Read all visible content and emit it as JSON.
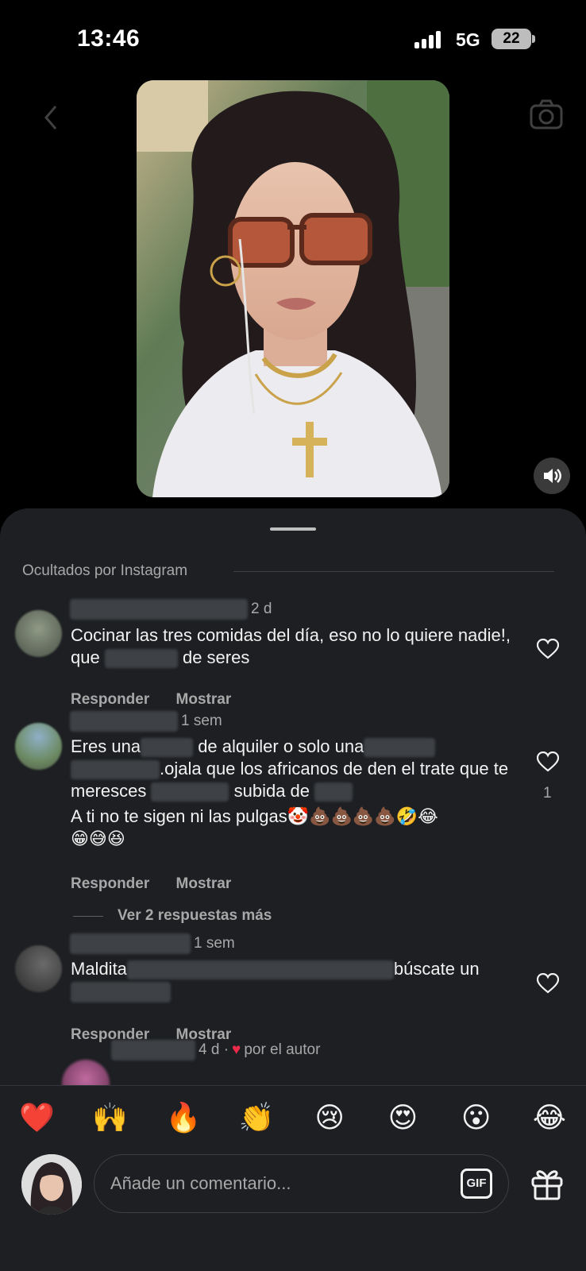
{
  "status_bar": {
    "time": "13:46",
    "network": "5G",
    "battery": "22"
  },
  "sheet": {
    "section_title": "Ocultados por Instagram"
  },
  "comments": [
    {
      "time": "2 d",
      "text_parts": [
        "Cocinar las tres comidas del día, eso no lo quiere nadie!, que",
        "de seres"
      ],
      "reply_label": "Responder",
      "show_label": "Mostrar"
    },
    {
      "time": "1 sem",
      "text_parts": [
        "Eres una",
        "de alquiler o solo una",
        ".ojala que los africanos de den el trate que te meresces",
        "subida de"
      ],
      "text_line2": "A ti no te sigen ni las pulgas",
      "emojis_line2": "🤡💩💩💩💩🤣😂",
      "emojis_line3": "😁😅😆",
      "likes": "1",
      "reply_label": "Responder",
      "show_label": "Mostrar",
      "more_replies": "Ver 2 respuestas más"
    },
    {
      "time": "1 sem",
      "text_parts": [
        "Maldita",
        "búscate un"
      ],
      "reply_label": "Responder",
      "show_label": "Mostrar"
    },
    {
      "time": "4 d ·",
      "liked_by_author": "por el autor"
    }
  ],
  "composer": {
    "reactions": [
      "❤️",
      "🙌",
      "🔥",
      "👏",
      "😢",
      "😍",
      "😮",
      "😂"
    ],
    "placeholder": "Añade un comentario...",
    "gif_label": "GIF"
  }
}
